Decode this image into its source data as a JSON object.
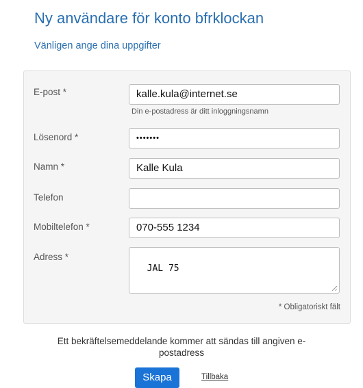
{
  "header": {
    "title": "Ny användare för konto bfrklockan",
    "subtitle": "Vänligen ange dina uppgifter"
  },
  "form": {
    "email": {
      "label": "E-post *",
      "value": "kalle.kula@internet.se",
      "help": "Din e-postadress är ditt inloggningsnamn"
    },
    "password": {
      "label": "Lösenord *",
      "value": "•••••••"
    },
    "name": {
      "label": "Namn *",
      "value": "Kalle Kula"
    },
    "phone": {
      "label": "Telefon",
      "value": ""
    },
    "mobile": {
      "label": "Mobiltelefon *",
      "value": "070-555 1234"
    },
    "address": {
      "label": "Adress *",
      "value": "JAL 75"
    },
    "required_note": "* Obligatoriskt fält"
  },
  "footer": {
    "message": "Ett bekräftelsemeddelande kommer att sändas till angiven e-postadress",
    "submit_label": "Skapa",
    "back_label": "Tillbaka"
  }
}
